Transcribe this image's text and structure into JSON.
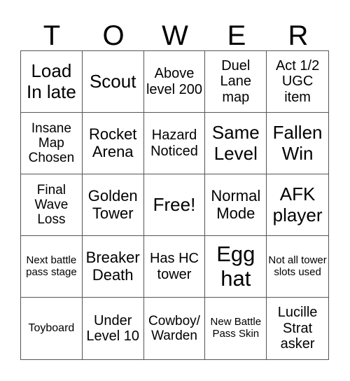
{
  "header": {
    "letters": [
      "T",
      "O",
      "W",
      "E",
      "R"
    ]
  },
  "cells": [
    "Load In late",
    "Scout",
    "Above level 200",
    "Duel Lane map",
    "Act 1/2 UGC item",
    "Insane Map Chosen",
    "Rocket Arena",
    "Hazard Noticed",
    "Same Level",
    "Fallen Win",
    "Final Wave Loss",
    "Golden Tower",
    "Free!",
    "Normal Mode",
    "AFK player",
    "Next battle pass stage",
    "Breaker Death",
    "Has HC tower",
    "Egg hat",
    "Not all tower slots used",
    "Toyboard",
    "Under Level 10",
    "Cowboy/ Warden",
    "New Battle Pass Skin",
    "Lucille Strat asker"
  ]
}
